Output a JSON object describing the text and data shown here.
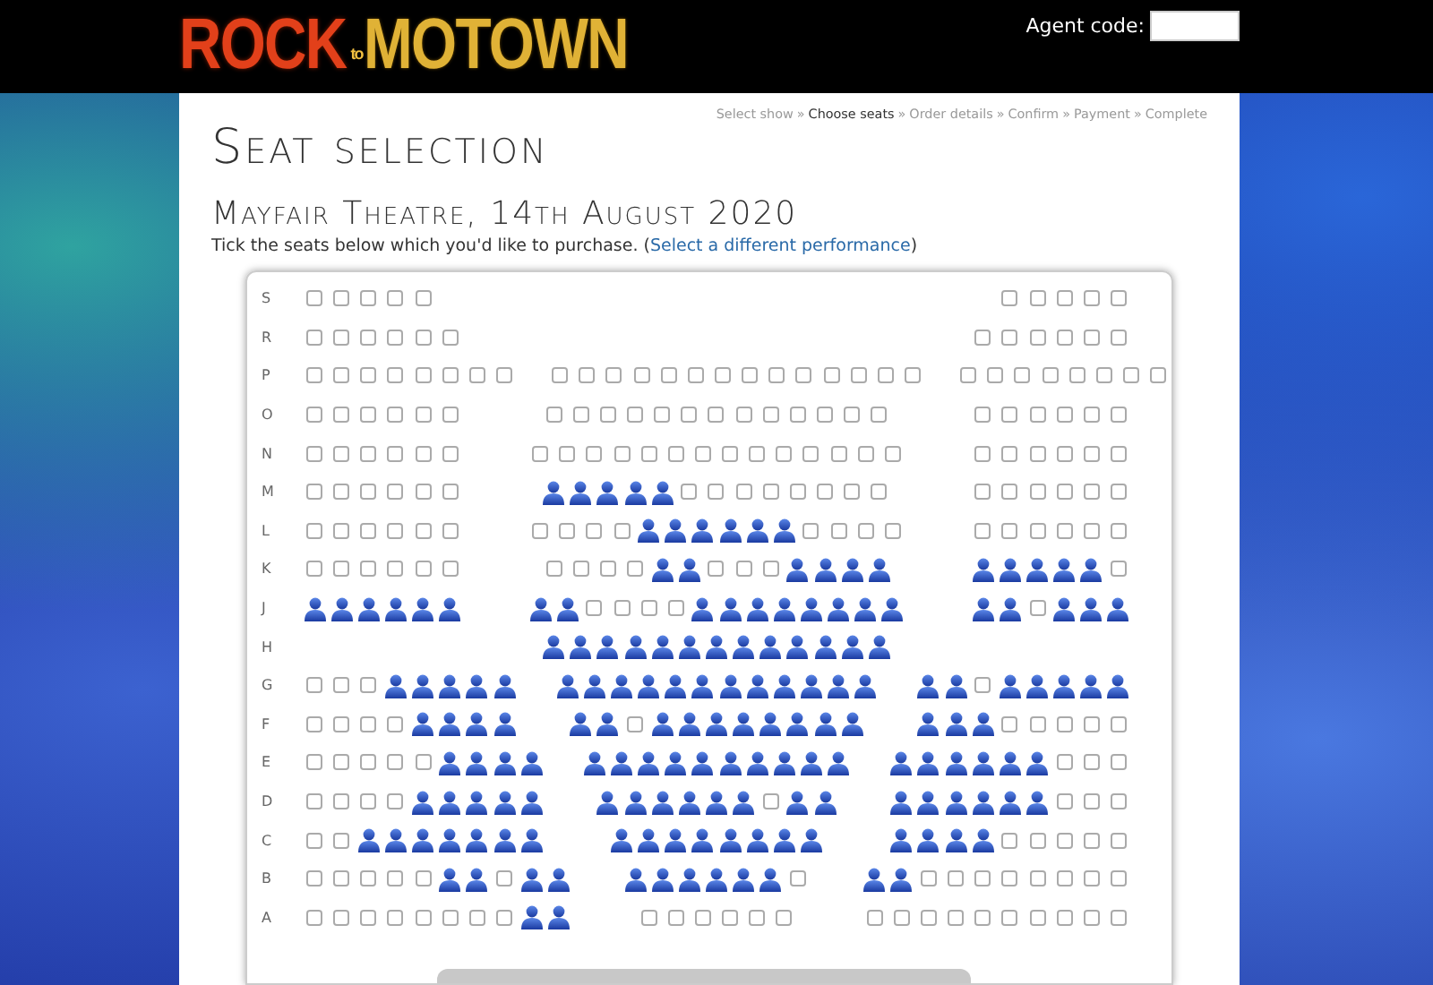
{
  "header": {
    "logo": {
      "word_1": "ROCK",
      "joiner": "to",
      "word_2": "MOTOWN"
    },
    "agent_code": {
      "label": "Agent code:"
    }
  },
  "breadcrumb": {
    "separator": "»",
    "steps": [
      {
        "label": "Select show",
        "selected": false
      },
      {
        "label": "Choose seats",
        "selected": true
      },
      {
        "label": "Order details",
        "selected": false
      },
      {
        "label": "Confirm",
        "selected": false
      },
      {
        "label": "Payment",
        "selected": false
      },
      {
        "label": "Complete",
        "selected": false
      }
    ]
  },
  "title": "Seat selection",
  "performance": "Mayfair Theatre, 14th August 2020",
  "instructions": {
    "text": "Tick the seats below which you'd like to purchase. (",
    "link": "Select a different performance",
    "after": ")"
  },
  "seat_map": {
    "rows": [
      {
        "label": "S",
        "sections": [
          {
            "kind": "left",
            "taken": [
              false,
              false,
              false,
              false,
              false
            ]
          },
          {
            "kind": "right",
            "taken": [
              false,
              false,
              false,
              false,
              false
            ]
          }
        ]
      },
      {
        "label": "R",
        "sections": [
          {
            "kind": "left",
            "taken": [
              false,
              false,
              false,
              false,
              false,
              false
            ]
          },
          {
            "kind": "right",
            "taken": [
              false,
              false,
              false,
              false,
              false,
              false
            ]
          }
        ]
      },
      {
        "label": "P",
        "sections": [
          {
            "kind": "left",
            "taken": [
              false,
              false,
              false,
              false,
              false,
              false,
              false,
              false
            ]
          },
          {
            "kind": "center",
            "taken": [
              false,
              false,
              false,
              false,
              false,
              false,
              false,
              false,
              false,
              false,
              false,
              false,
              false,
              false
            ]
          },
          {
            "kind": "right",
            "taken": [
              false,
              false,
              false,
              false,
              false,
              false,
              false,
              false
            ]
          }
        ]
      },
      {
        "label": "O",
        "sections": [
          {
            "kind": "left",
            "taken": [
              false,
              false,
              false,
              false,
              false,
              false
            ]
          },
          {
            "kind": "center",
            "taken": [
              false,
              false,
              false,
              false,
              false,
              false,
              false,
              false,
              false,
              false,
              false,
              false,
              false
            ]
          },
          {
            "kind": "right",
            "taken": [
              false,
              false,
              false,
              false,
              false,
              false
            ]
          }
        ]
      },
      {
        "label": "N",
        "sections": [
          {
            "kind": "left",
            "taken": [
              false,
              false,
              false,
              false,
              false,
              false
            ]
          },
          {
            "kind": "center",
            "taken": [
              false,
              false,
              false,
              false,
              false,
              false,
              false,
              false,
              false,
              false,
              false,
              false,
              false,
              false
            ]
          },
          {
            "kind": "right",
            "taken": [
              false,
              false,
              false,
              false,
              false,
              false
            ]
          }
        ]
      },
      {
        "label": "M",
        "sections": [
          {
            "kind": "left",
            "taken": [
              false,
              false,
              false,
              false,
              false,
              false
            ]
          },
          {
            "kind": "center",
            "taken": [
              true,
              true,
              true,
              true,
              true,
              false,
              false,
              false,
              false,
              false,
              false,
              false,
              false
            ]
          },
          {
            "kind": "right",
            "taken": [
              false,
              false,
              false,
              false,
              false,
              false
            ]
          }
        ]
      },
      {
        "label": "L",
        "sections": [
          {
            "kind": "left",
            "taken": [
              false,
              false,
              false,
              false,
              false,
              false
            ]
          },
          {
            "kind": "center",
            "taken": [
              false,
              false,
              false,
              false,
              true,
              true,
              true,
              true,
              true,
              true,
              false,
              false,
              false,
              false
            ]
          },
          {
            "kind": "right",
            "taken": [
              false,
              false,
              false,
              false,
              false,
              false
            ]
          }
        ]
      },
      {
        "label": "K",
        "sections": [
          {
            "kind": "left",
            "taken": [
              false,
              false,
              false,
              false,
              false,
              false
            ]
          },
          {
            "kind": "center",
            "taken": [
              false,
              false,
              false,
              false,
              true,
              true,
              false,
              false,
              false,
              true,
              true,
              true,
              true
            ]
          },
          {
            "kind": "right",
            "taken": [
              true,
              true,
              true,
              true,
              true,
              false
            ]
          }
        ]
      },
      {
        "label": "J",
        "sections": [
          {
            "kind": "left",
            "taken": [
              true,
              true,
              true,
              true,
              true,
              true
            ]
          },
          {
            "kind": "center",
            "taken": [
              true,
              true,
              false,
              false,
              false,
              false,
              true,
              true,
              true,
              true,
              true,
              true,
              true,
              true
            ]
          },
          {
            "kind": "right",
            "taken": [
              true,
              true,
              false,
              true,
              true,
              true
            ]
          }
        ]
      },
      {
        "label": "H",
        "sections": [
          {
            "kind": "center",
            "taken": [
              true,
              true,
              true,
              true,
              true,
              true,
              true,
              true,
              true,
              true,
              true,
              true,
              true
            ]
          }
        ]
      },
      {
        "label": "G",
        "sections": [
          {
            "kind": "left",
            "taken": [
              false,
              false,
              false,
              true,
              true,
              true,
              true,
              true
            ]
          },
          {
            "kind": "center",
            "taken": [
              true,
              true,
              true,
              true,
              true,
              true,
              true,
              true,
              true,
              true,
              true,
              true
            ]
          },
          {
            "kind": "right",
            "taken": [
              true,
              true,
              false,
              true,
              true,
              true,
              true,
              true
            ]
          }
        ]
      },
      {
        "label": "F",
        "sections": [
          {
            "kind": "left",
            "taken": [
              false,
              false,
              false,
              false,
              true,
              true,
              true,
              true
            ]
          },
          {
            "kind": "center",
            "taken": [
              true,
              true,
              false,
              true,
              true,
              true,
              true,
              true,
              true,
              true,
              true
            ]
          },
          {
            "kind": "right",
            "taken": [
              true,
              true,
              true,
              false,
              false,
              false,
              false,
              false
            ]
          }
        ]
      },
      {
        "label": "E",
        "sections": [
          {
            "kind": "left",
            "taken": [
              false,
              false,
              false,
              false,
              false,
              true,
              true,
              true,
              true
            ]
          },
          {
            "kind": "center",
            "taken": [
              true,
              true,
              true,
              true,
              true,
              true,
              true,
              true,
              true,
              true
            ]
          },
          {
            "kind": "right",
            "taken": [
              true,
              true,
              true,
              true,
              true,
              true,
              false,
              false,
              false
            ]
          }
        ]
      },
      {
        "label": "D",
        "sections": [
          {
            "kind": "left",
            "taken": [
              false,
              false,
              false,
              false,
              true,
              true,
              true,
              true,
              true
            ]
          },
          {
            "kind": "center",
            "taken": [
              true,
              true,
              true,
              true,
              true,
              true,
              false,
              true,
              true
            ]
          },
          {
            "kind": "right",
            "taken": [
              true,
              true,
              true,
              true,
              true,
              true,
              false,
              false,
              false
            ]
          }
        ]
      },
      {
        "label": "C",
        "sections": [
          {
            "kind": "left",
            "taken": [
              false,
              false,
              true,
              true,
              true,
              true,
              true,
              true,
              true
            ]
          },
          {
            "kind": "center",
            "taken": [
              true,
              true,
              true,
              true,
              true,
              true,
              true,
              true
            ]
          },
          {
            "kind": "right",
            "taken": [
              true,
              true,
              true,
              true,
              false,
              false,
              false,
              false,
              false
            ]
          }
        ]
      },
      {
        "label": "B",
        "sections": [
          {
            "kind": "left",
            "taken": [
              false,
              false,
              false,
              false,
              false,
              true,
              true,
              false,
              true,
              true
            ]
          },
          {
            "kind": "center",
            "taken": [
              true,
              true,
              true,
              true,
              true,
              true,
              false
            ]
          },
          {
            "kind": "right",
            "taken": [
              true,
              true,
              false,
              false,
              false,
              false,
              false,
              false,
              false,
              false
            ]
          }
        ]
      },
      {
        "label": "A",
        "sections": [
          {
            "kind": "left",
            "taken": [
              false,
              false,
              false,
              false,
              false,
              false,
              false,
              false,
              true,
              true
            ]
          },
          {
            "kind": "center",
            "taken": [
              false,
              false,
              false,
              false,
              false,
              false
            ]
          },
          {
            "kind": "right",
            "taken": [
              false,
              false,
              false,
              false,
              false,
              false,
              false,
              false,
              false,
              false
            ]
          }
        ]
      }
    ]
  }
}
